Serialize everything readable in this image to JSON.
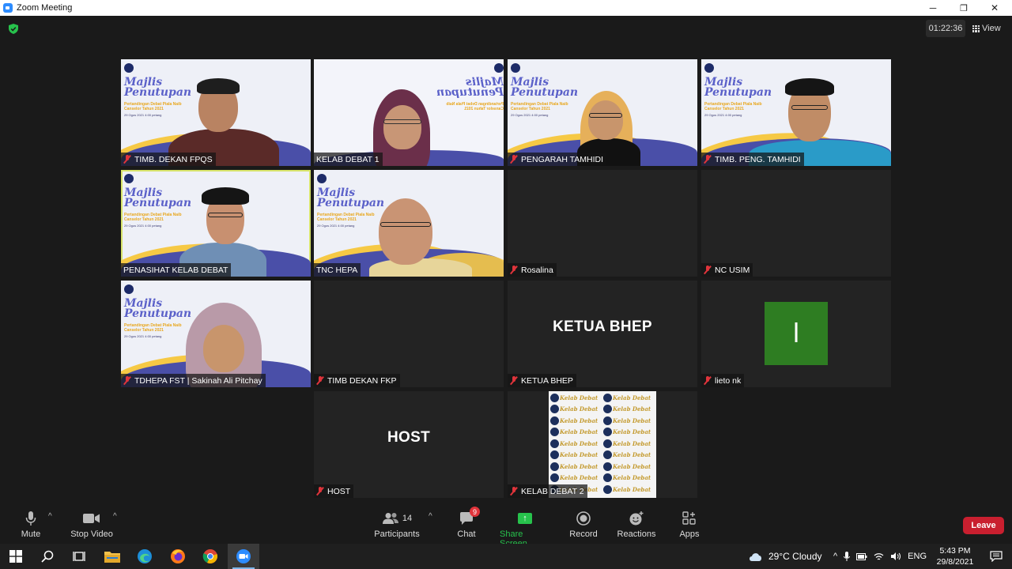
{
  "window": {
    "title": "Zoom Meeting",
    "minimize": "─",
    "restore": "❐",
    "close": "✕"
  },
  "meeting": {
    "timer": "01:22:36",
    "view_label": "View"
  },
  "banner": {
    "line1": "Majlis",
    "line2": "Penutupan",
    "sub": "Pertandingan Debat Piala Naib Canselor Tahun 2021",
    "date": "29 Ogos 2021 4:00 petang"
  },
  "tiles": [
    {
      "name": "TIMB. DEKAN FPQS",
      "muted": true
    },
    {
      "name": "KELAB DEBAT 1",
      "muted": false
    },
    {
      "name": "PENGARAH TAMHIDI",
      "muted": true
    },
    {
      "name": "TIMB. PENG. TAMHIDI",
      "muted": true
    },
    {
      "name": "PENASIHAT KELAB DEBAT",
      "muted": false
    },
    {
      "name": "TNC HEPA",
      "muted": false
    },
    {
      "name": "Rosalina",
      "muted": true
    },
    {
      "name": "NC USIM",
      "muted": true
    },
    {
      "name": "TDHEPA FST | Sakinah Ali Pitchay",
      "muted": true
    },
    {
      "name": "TIMB DEKAN FKP",
      "muted": true
    },
    {
      "name": "KETUA BHEP",
      "muted": true,
      "display": "KETUA BHEP"
    },
    {
      "name": "lieto nk",
      "muted": true,
      "avatar": "l"
    },
    {
      "name": "HOST",
      "muted": true,
      "display": "HOST"
    },
    {
      "name": "KELAB DEBAT 2",
      "muted": true
    }
  ],
  "shared_pattern_text": "Kelab Debat",
  "controls": {
    "mute": "Mute",
    "stop_video": "Stop Video",
    "participants": "Participants",
    "participants_count": "14",
    "chat": "Chat",
    "chat_badge": "9",
    "share_screen": "Share Screen",
    "record": "Record",
    "reactions": "Reactions",
    "apps": "Apps",
    "leave": "Leave"
  },
  "taskbar": {
    "weather": "29°C  Cloudy",
    "lang": "ENG",
    "time": "5:43 PM",
    "date": "29/8/2021"
  },
  "colors": {
    "accent_green": "#27c24c",
    "leave_red": "#c91f2f",
    "mute_red": "#e0343b",
    "active_speaker": "#d7e36a"
  }
}
